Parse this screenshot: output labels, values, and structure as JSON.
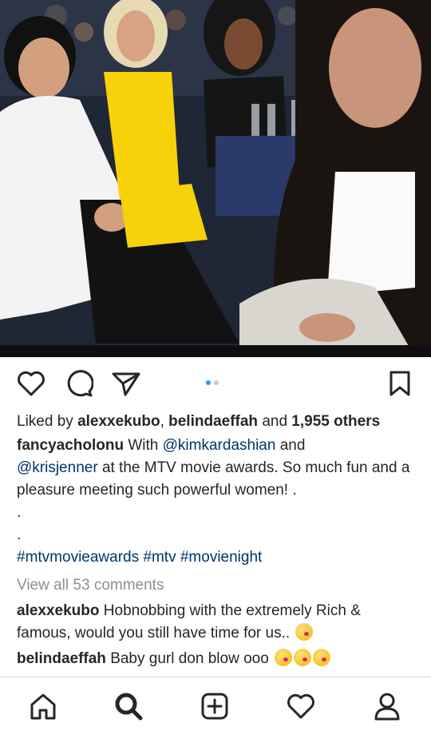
{
  "post": {
    "photo": {
      "description_icon": "photo-icon",
      "colors": {
        "bg": "#1b2230",
        "white_outfit": "#f5f5f5",
        "yellow_dress": "#f7d10a",
        "skin": "#d7a384",
        "black_hair": "#1a1a1a"
      }
    },
    "carousel": {
      "pages": 2,
      "active": 1
    },
    "likes": {
      "prefix": "Liked by",
      "user1": "alexxekubo",
      "sep": ",",
      "user2": "belindaeffah",
      "and": "and",
      "count": "1,955 others"
    },
    "caption": {
      "username": "fancyacholonu",
      "part1": "With",
      "mention1": "@kimkardashian",
      "part2": "and",
      "mention2": "@krisjenner",
      "part3": "at the MTV movie awards. So much fun and a pleasure meeting such powerful women! .",
      "dot1": ".",
      "dot2": ".",
      "hashtag1": "#mtvmovieawards",
      "hashtag2": "#mtv",
      "hashtag3": "#movienight"
    },
    "view_comments": "View all 53 comments",
    "comments": [
      {
        "user": "alexxekubo",
        "text": "Hobnobbing with the extremely Rich & famous, would you still have time for us.."
      },
      {
        "user": "belindaeffah",
        "text": "Baby gurl don blow ooo"
      }
    ]
  },
  "nav": {
    "items": [
      "home-icon",
      "search-icon",
      "add-post-icon",
      "activity-heart-icon",
      "profile-icon"
    ]
  },
  "colors": {
    "accent": "#3897f0",
    "link": "#003569",
    "text": "#262626",
    "muted": "#8e8e8e"
  }
}
